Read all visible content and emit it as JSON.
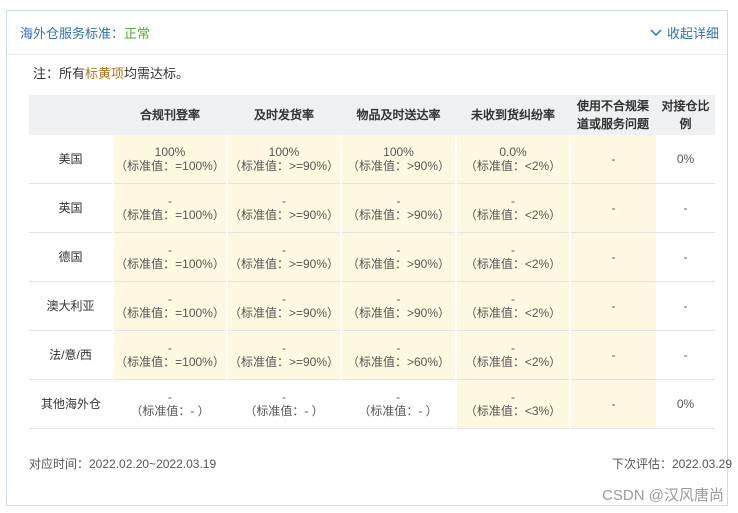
{
  "header": {
    "title": "海外仓服务标准：",
    "status": "正常",
    "toggle_label": "收起详细"
  },
  "note": {
    "prefix": "注：所有",
    "highlight": "标黄项",
    "suffix": "均需达标。"
  },
  "table": {
    "columns": [
      "",
      "合规刊登率",
      "及时发货率",
      "物品及时送达率",
      "未收到货纠纷率",
      "使用不合规渠道或服务问题",
      "对接仓比例"
    ],
    "rows": [
      {
        "country": "美国",
        "cells": [
          {
            "value": "100%",
            "std": "（标准值：=100%）"
          },
          {
            "value": "100%",
            "std": "（标准值：>=90%）"
          },
          {
            "value": "100%",
            "std": "（标准值：>90%）"
          },
          {
            "value": "0.0%",
            "std": "（标准值：<2%）"
          },
          {
            "value": "-",
            "std": ""
          },
          {
            "value": "0%",
            "std": ""
          }
        ]
      },
      {
        "country": "英国",
        "cells": [
          {
            "value": "-",
            "std": "（标准值：=100%）"
          },
          {
            "value": "-",
            "std": "（标准值：>=90%）"
          },
          {
            "value": "-",
            "std": "（标准值：>90%）"
          },
          {
            "value": "-",
            "std": "（标准值：<2%）"
          },
          {
            "value": "-",
            "std": ""
          },
          {
            "value": "-",
            "std": ""
          }
        ]
      },
      {
        "country": "德国",
        "cells": [
          {
            "value": "-",
            "std": "（标准值：=100%）"
          },
          {
            "value": "-",
            "std": "（标准值：>=90%）"
          },
          {
            "value": "-",
            "std": "（标准值：>90%）"
          },
          {
            "value": "-",
            "std": "（标准值：<2%）"
          },
          {
            "value": "-",
            "std": ""
          },
          {
            "value": "-",
            "std": ""
          }
        ]
      },
      {
        "country": "澳大利亚",
        "cells": [
          {
            "value": "-",
            "std": "（标准值：=100%）"
          },
          {
            "value": "-",
            "std": "（标准值：>=90%）"
          },
          {
            "value": "-",
            "std": "（标准值：>90%）"
          },
          {
            "value": "-",
            "std": "（标准值：<2%）"
          },
          {
            "value": "-",
            "std": ""
          },
          {
            "value": "-",
            "std": ""
          }
        ]
      },
      {
        "country": "法/意/西",
        "cells": [
          {
            "value": "-",
            "std": "（标准值：=100%）"
          },
          {
            "value": "-",
            "std": "（标准值：>=90%）"
          },
          {
            "value": "-",
            "std": "（标准值：>60%）"
          },
          {
            "value": "-",
            "std": "（标准值：<2%）"
          },
          {
            "value": "-",
            "std": ""
          },
          {
            "value": "-",
            "std": ""
          }
        ]
      },
      {
        "country": "其他海外仓",
        "cells": [
          {
            "value": "-",
            "std": "（标准值：- ）"
          },
          {
            "value": "-",
            "std": "（标准值：- ）"
          },
          {
            "value": "-",
            "std": "（标准值：- ）"
          },
          {
            "value": "-",
            "std": "（标准值：<3%）"
          },
          {
            "value": "-",
            "std": ""
          },
          {
            "value": "0%",
            "std": ""
          }
        ]
      }
    ]
  },
  "footer": {
    "period": "对应时间：2022.02.20~2022.03.19",
    "next_eval": "下次评估：2022.03.29"
  },
  "watermark": "CSDN @汉风唐尚"
}
